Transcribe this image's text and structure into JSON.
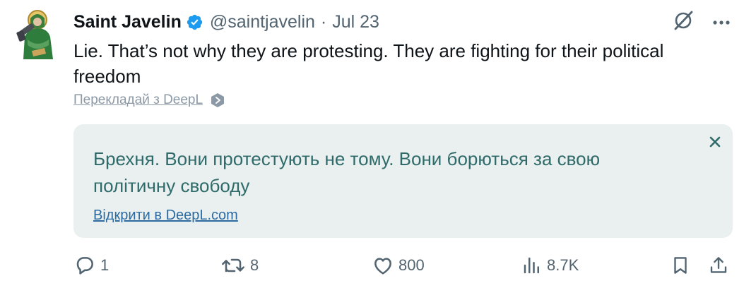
{
  "tweet": {
    "author_name": "Saint Javelin",
    "handle": "@saintjavelin",
    "separator": "·",
    "date": "Jul 23",
    "text": "Lie. That’s not why they are protesting. They are fighting for their political freedom"
  },
  "translation": {
    "translate_link": "Перекладай з DeepL",
    "translated_text": "Брехня. Вони протестують не тому. Вони борються за свою політичну свободу",
    "open_link": "Відкрити в DeepL.com"
  },
  "stats": {
    "replies": "1",
    "retweets": "8",
    "likes": "800",
    "views": "8.7K"
  },
  "icons": {
    "verified": "verified-badge-icon",
    "grok": "grok-icon",
    "more": "more-icon",
    "close": "close-icon",
    "reply": "reply-icon",
    "retweet": "retweet-icon",
    "like": "heart-icon",
    "views": "views-icon",
    "bookmark": "bookmark-icon",
    "share": "share-icon"
  },
  "colors": {
    "verified": "#1d9bf0",
    "translation_bg": "#e9f0ef",
    "translation_text": "#2f6b6a",
    "link": "#2d6aa0",
    "secondary": "#536471"
  }
}
